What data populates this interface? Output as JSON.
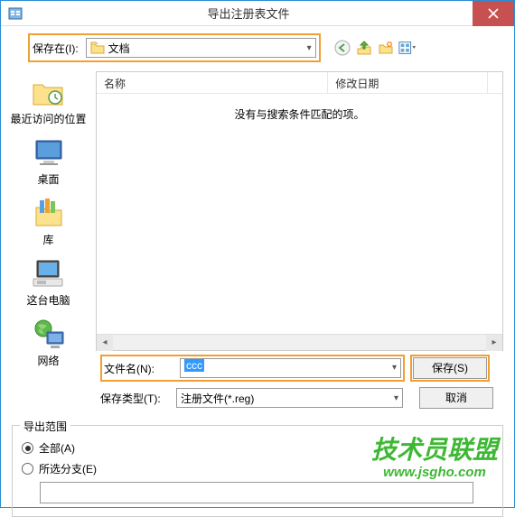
{
  "title": "导出注册表文件",
  "savein": {
    "label": "保存在(I):",
    "value": "文档"
  },
  "columns": {
    "name": "名称",
    "date": "修改日期"
  },
  "empty_msg": "没有与搜索条件匹配的项。",
  "sidebar": {
    "recent": "最近访问的位置",
    "desktop": "桌面",
    "library": "库",
    "computer": "这台电脑",
    "network": "网络"
  },
  "filename": {
    "label": "文件名(N):",
    "value": "ccc"
  },
  "filetype": {
    "label": "保存类型(T):",
    "value": "注册文件(*.reg)"
  },
  "buttons": {
    "save": "保存(S)",
    "cancel": "取消"
  },
  "export": {
    "title": "导出范围",
    "all": "全部(A)",
    "branch": "所选分支(E)"
  },
  "watermark": {
    "text": "技术员联盟",
    "url": "www.jsgho.com"
  }
}
